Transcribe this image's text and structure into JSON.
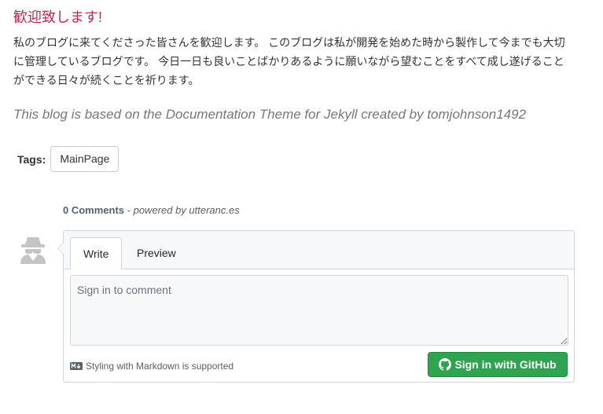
{
  "page": {
    "title": "歓迎致します!",
    "intro": "私のブログに来てくださった皆さんを歓迎します。 このブログは私が開発を始めた時から製作して今までも大切に管理しているブログです。 今日一日も良いことばかりあるように願いながら望むことをすべて成し遂げることができる日々が続くことを祈ります。",
    "credit": "This blog is based on the Documentation Theme for Jekyll created by tomjohnson1492"
  },
  "tags": {
    "label": "Tags:",
    "items": [
      "MainPage"
    ]
  },
  "comments": {
    "count_label": "0 Comments",
    "separator": " - ",
    "powered_by": "powered by utteranc.es",
    "avatar_icon": "anonymous-user-icon",
    "tabs": [
      {
        "label": "Write",
        "active": true
      },
      {
        "label": "Preview",
        "active": false
      }
    ],
    "placeholder": "Sign in to comment",
    "markdown_note": "Styling with Markdown is supported",
    "markdown_icon": "markdown-icon",
    "signin_label": "Sign in with GitHub",
    "signin_icon": "github-icon"
  },
  "colors": {
    "title": "#c7254e",
    "credit": "#777777",
    "signin_button": "#2ea44f",
    "avatar": "#c4c4c4"
  }
}
